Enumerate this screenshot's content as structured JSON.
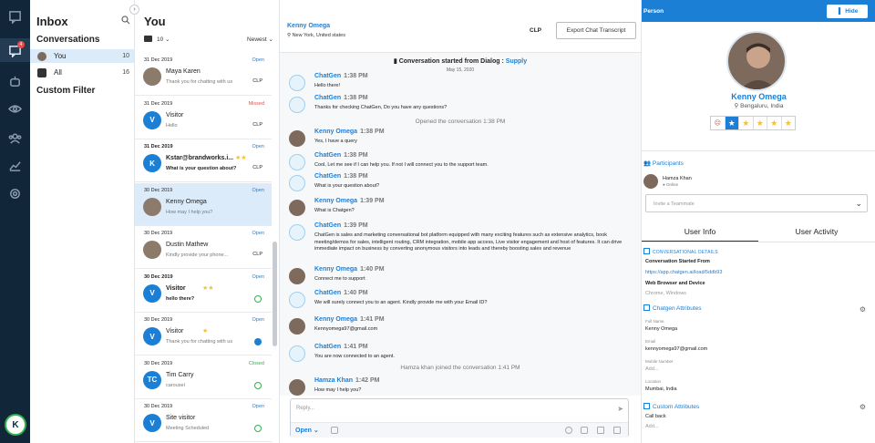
{
  "nav": {
    "user_initial": "K",
    "unread_badge": "4"
  },
  "inbox": {
    "title": "Inbox",
    "conversations_label": "Conversations",
    "items": [
      {
        "label": "You",
        "count": "10"
      },
      {
        "label": "All",
        "count": "16"
      }
    ],
    "custom_filter": "Custom Filter"
  },
  "list": {
    "title": "You",
    "page_size": "10",
    "sort": "Newest",
    "conversations": [
      {
        "date": "31 Dec 2019",
        "name": "Maya Karen",
        "message": "Thank you for chatting with us",
        "status": "Open",
        "channel": "CLP",
        "initials": "",
        "bold": false,
        "stars": ""
      },
      {
        "date": "31 Dec 2019",
        "name": "Visitor",
        "message": "Hello",
        "status": "Missed",
        "channel": "CLP",
        "initials": "V",
        "bold": false,
        "stars": ""
      },
      {
        "date": "31 Dec 2019",
        "name": "Kstar@brandworks.i...",
        "message": "What is your question about?",
        "status": "Open",
        "channel": "CLP",
        "initials": "K",
        "bold": true,
        "stars": "★★"
      },
      {
        "date": "30 Dec 2019",
        "name": "Kenny Omega",
        "message": "How may I help you?",
        "status": "Open",
        "channel": "",
        "initials": "",
        "bold": false,
        "stars": ""
      },
      {
        "date": "30 Dec 2019",
        "name": "Dustin Mathew",
        "message": "Kindly provide your phone...",
        "status": "Open",
        "channel": "CLP",
        "initials": "",
        "bold": false,
        "stars": ""
      },
      {
        "date": "30 Dec 2019",
        "name": "Visitor",
        "message": "hello there?",
        "status": "Open",
        "channel": "whatsapp",
        "initials": "V",
        "bold": true,
        "stars": "★★"
      },
      {
        "date": "30 Dec 2019",
        "name": "Visitor",
        "message": "Thank you for chatting with us",
        "status": "Open",
        "channel": "messenger",
        "initials": "V",
        "bold": false,
        "stars": "★"
      },
      {
        "date": "30 Dec 2019",
        "name": "Tim Carry",
        "message": "carousel",
        "status": "Closed",
        "channel": "whatsapp",
        "initials": "TC",
        "bold": false,
        "stars": ""
      },
      {
        "date": "30 Dec 2019",
        "name": "Site visitor",
        "message": "Meeting Scheduled",
        "status": "Open",
        "channel": "whatsapp",
        "initials": "V",
        "bold": false,
        "stars": ""
      }
    ]
  },
  "chat": {
    "contact_name": "Kenny Omega",
    "contact_location": "New York, United states",
    "channel": "CLP",
    "export_label": "Export Chat Transcript",
    "started_prefix": "Conversation started from Dialog :",
    "started_dialog": "Supply",
    "date": "May 15, 2020",
    "messages": [
      {
        "kind": "bot",
        "who": "ChatGen",
        "time": "1:38 PM",
        "text": "Hello there!"
      },
      {
        "kind": "bot",
        "who": "ChatGen",
        "time": "1:38 PM",
        "text": "Thanks for checking ChatGen, Do you have any questions?"
      },
      {
        "kind": "sys",
        "text": "Opened the conversation  1:38 PM"
      },
      {
        "kind": "usr",
        "who": "Kenny Omega",
        "time": "1:38 PM",
        "text": "Yes, I have a query"
      },
      {
        "kind": "bot",
        "who": "ChatGen",
        "time": "1:38 PM",
        "text": "Cool, Let me see if I can help you. If not I will connect you to the support team."
      },
      {
        "kind": "bot",
        "who": "ChatGen",
        "time": "1:38 PM",
        "text": "What is your question about?"
      },
      {
        "kind": "usr",
        "who": "Kenny Omega",
        "time": "1:39 PM",
        "text": "What is Chatgen?"
      },
      {
        "kind": "bot",
        "who": "ChatGen",
        "time": "1:39 PM",
        "text": "ChatGen is sales and marketing conversational bot  platform  equipped with many exciting features such as extensive analytics, book meeting/demos for sales, intelligent routing, CRM integration, mobile app access, Live visitor engagement and host of features. It can drive immediate impact on business by converting anonymous visitors into leads and thereby boosting sales and revenue"
      },
      {
        "kind": "usr",
        "who": "Kenny Omega",
        "time": "1:40 PM",
        "text": "Connect me to support"
      },
      {
        "kind": "bot",
        "who": "ChatGen",
        "time": "1:40 PM",
        "text": "We will surely connect you to an agent. Kindly provide me with your Email ID?"
      },
      {
        "kind": "usr",
        "who": "Kenny Omega",
        "time": "1:41 PM",
        "text": "Kennyomega97@gmail.com"
      },
      {
        "kind": "bot",
        "who": "ChatGen",
        "time": "1:41 PM",
        "text": "You are now connected to an agent."
      },
      {
        "kind": "sys",
        "text": "Hamza khan joined the conversation  1:41 PM"
      },
      {
        "kind": "usr",
        "who": "Hamza Khan",
        "time": "1:42 PM",
        "text": "How may I help you?"
      }
    ],
    "reply_placeholder": "Reply...",
    "status_select": "Open"
  },
  "person": {
    "header": "Person",
    "hide_label": "Hide",
    "name": "Kenny Omega",
    "location": "Bengaluru, India",
    "participants_label": "Participants",
    "participant_name": "Hamza Khan",
    "participant_status": "Online",
    "invite_placeholder": "Invite a Teammate",
    "tab_info": "User Info",
    "tab_activity": "User Activity",
    "conv_details_label": "CONVERSATIONAL DETAILS",
    "started_from_label": "Conversation Started From",
    "started_from_url": "https://app.chatgen.ai/load/5ddb93",
    "browser_label": "Web Browser and Device",
    "browser_value": "Chrome, Windows",
    "chatgen_attr_label": "Chatgen Attributes",
    "full_name_label": "Full Name",
    "full_name": "Kenny Omega",
    "email_label": "Email",
    "email": "kennyomega97@gmail.com",
    "mobile_label": "Mobile Number",
    "mobile": "Add...",
    "location_label": "Location",
    "location_value": "Mumbai, India",
    "custom_attr_label": "Custom Attributes",
    "callback_label": "Call back",
    "callback_value": "Add...",
    "rating": 1
  },
  "colors": {
    "accent": "#1c7fd6",
    "rail": "#12263a",
    "missed": "#e84b4b",
    "closed": "#2fb34a"
  }
}
